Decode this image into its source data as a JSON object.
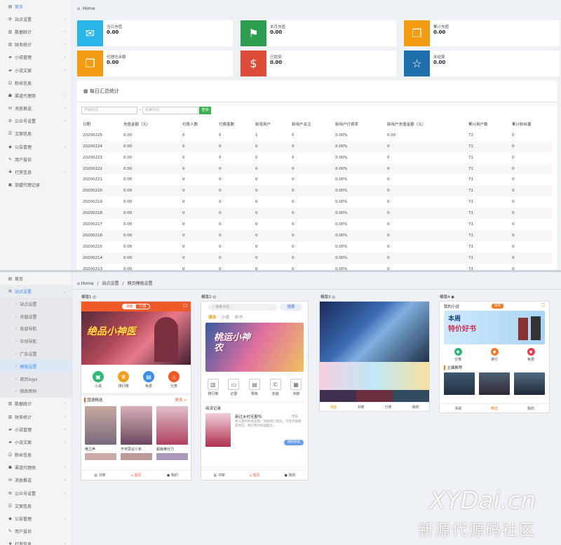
{
  "top": {
    "sidebar": [
      {
        "icon": "▤",
        "label": "首页",
        "active": true,
        "chev": false
      },
      {
        "icon": "⚙",
        "label": "站点设置",
        "chev": true
      },
      {
        "icon": "▥",
        "label": "数据统计",
        "chev": true
      },
      {
        "icon": "▥",
        "label": "财务统计",
        "chev": true
      },
      {
        "icon": "▰",
        "label": "小说管理",
        "chev": true
      },
      {
        "icon": "▰",
        "label": "小说文案",
        "chev": true
      },
      {
        "icon": "☺",
        "label": "粉丝信息",
        "chev": false
      },
      {
        "icon": "☗",
        "label": "渠道代理商",
        "chev": true
      },
      {
        "icon": "✉",
        "label": "消息推送",
        "chev": true
      },
      {
        "icon": "⚙",
        "label": "公众号设置",
        "chev": true
      },
      {
        "icon": "☰",
        "label": "文案信息",
        "chev": false
      },
      {
        "icon": "◆",
        "label": "公告管理",
        "chev": true
      },
      {
        "icon": "✎",
        "label": "用户投诉",
        "chev": false
      },
      {
        "icon": "✚",
        "label": "打赏信息",
        "chev": true
      },
      {
        "icon": "▣",
        "label": "加盟代理记录",
        "chev": false
      }
    ],
    "breadcrumb": [
      "⌂",
      "Home"
    ],
    "cards": [
      {
        "label": "当日充值",
        "value": "0.00",
        "color": "#2ab5e8",
        "icon": "✉"
      },
      {
        "label": "本月充值",
        "value": "0.00",
        "color": "#2e9e4e",
        "icon": "⚑"
      },
      {
        "label": "累计充值",
        "value": "0.00",
        "color": "#f39c12",
        "icon": "❐"
      },
      {
        "label": "代理总余额",
        "value": "0.00",
        "color": "#f39c12",
        "icon": "❐"
      },
      {
        "label": "已提现",
        "value": "0.00",
        "color": "#dd4b39",
        "icon": "$"
      },
      {
        "label": "未结算",
        "value": "0.00",
        "color": "#1f6fad",
        "icon": "☆"
      }
    ],
    "panel": {
      "title": "每日汇总统计",
      "start_placeholder": "开始时间",
      "dash": "-",
      "end_placeholder": "结束时间",
      "query": "查询",
      "headers": [
        "日期",
        "充值金额（元）",
        "付费人数",
        "付费笔数",
        "新增用户",
        "新用户关注",
        "新用户付费率",
        "新用户充值金额（元）",
        "累计用户数",
        "累计粉丝量"
      ],
      "rows": [
        [
          "20200225",
          "0.00",
          "0",
          "0",
          "1",
          "0",
          "0.00%",
          "0.00",
          "72",
          "0"
        ],
        [
          "20200224",
          "0.00",
          "0",
          "0",
          "0",
          "0",
          "0.00%",
          "0",
          "71",
          "0"
        ],
        [
          "20200223",
          "0.00",
          "0",
          "0",
          "0",
          "0",
          "0.00%",
          "0",
          "71",
          "0"
        ],
        [
          "20200222",
          "0.00",
          "0",
          "0",
          "0",
          "0",
          "0.00%",
          "0",
          "71",
          "0"
        ],
        [
          "20200221",
          "0.00",
          "0",
          "0",
          "0",
          "0",
          "0.00%",
          "0",
          "71",
          "0"
        ],
        [
          "20200220",
          "0.00",
          "0",
          "0",
          "0",
          "0",
          "0.00%",
          "0",
          "71",
          "0"
        ],
        [
          "20200219",
          "0.00",
          "0",
          "0",
          "0",
          "0",
          "0.00%",
          "0",
          "71",
          "0"
        ],
        [
          "20200218",
          "0.00",
          "0",
          "0",
          "0",
          "0",
          "0.00%",
          "0",
          "71",
          "0"
        ],
        [
          "20200217",
          "0.00",
          "0",
          "0",
          "0",
          "0",
          "0.00%",
          "0",
          "71",
          "0"
        ],
        [
          "20200216",
          "0.00",
          "0",
          "0",
          "0",
          "0",
          "0.00%",
          "0",
          "71",
          "0"
        ],
        [
          "20200215",
          "0.00",
          "0",
          "0",
          "0",
          "0",
          "0.00%",
          "0",
          "71",
          "0"
        ],
        [
          "20200214",
          "0.00",
          "0",
          "0",
          "0",
          "0",
          "0.00%",
          "0",
          "71",
          "0"
        ],
        [
          "20200213",
          "0.00",
          "0",
          "0",
          "0",
          "0",
          "0.00%",
          "0",
          "71",
          "0"
        ]
      ]
    }
  },
  "bottom": {
    "sidebar_before": [
      {
        "icon": "▤",
        "label": "首页",
        "chev": false
      }
    ],
    "open_item": {
      "icon": "⚙",
      "label": "站点设置"
    },
    "subitems": [
      {
        "label": "站点设置"
      },
      {
        "label": "充值设置"
      },
      {
        "label": "底部导航"
      },
      {
        "label": "中间导航"
      },
      {
        "label": "广告设置"
      },
      {
        "label": "模版设置",
        "selected": true
      },
      {
        "label": "首页logo"
      },
      {
        "label": "修改密码"
      }
    ],
    "sidebar_after": [
      {
        "icon": "▥",
        "label": "数据统计",
        "chev": true
      },
      {
        "icon": "▥",
        "label": "财务统计",
        "chev": true
      },
      {
        "icon": "▰",
        "label": "小说管理",
        "chev": true
      },
      {
        "icon": "▰",
        "label": "小说文案",
        "chev": true
      },
      {
        "icon": "☺",
        "label": "粉丝信息",
        "chev": false
      },
      {
        "icon": "☗",
        "label": "渠道代理商",
        "chev": true
      },
      {
        "icon": "✉",
        "label": "消息推送",
        "chev": true
      },
      {
        "icon": "⚙",
        "label": "公众号设置",
        "chev": true
      },
      {
        "icon": "☰",
        "label": "文案信息",
        "chev": false
      },
      {
        "icon": "◆",
        "label": "公告管理",
        "chev": true
      },
      {
        "icon": "✎",
        "label": "用户投诉",
        "chev": false
      },
      {
        "icon": "✚",
        "label": "打赏信息",
        "chev": true
      }
    ],
    "breadcrumb": [
      "⌂ Home",
      "/",
      "站点设置",
      "/",
      "网页模板设置"
    ],
    "templates": [
      "模版1",
      "模版2",
      "模版3",
      "模版4"
    ],
    "t1": {
      "tabs": [
        "漫画",
        "小说"
      ],
      "banner": "绝品小神医",
      "icons": [
        {
          "label": "小说",
          "color": "#2eb872",
          "g": "▣"
        },
        {
          "label": "排行榜",
          "color": "#f0a020",
          "g": "♛"
        },
        {
          "label": "免费",
          "color": "#3a8ee6",
          "g": "▤"
        },
        {
          "label": "分类",
          "color": "#f05a28",
          "g": "♨"
        }
      ],
      "section": "国漫精选",
      "more": "更多 >",
      "books": [
        "绝之声",
        "不可思议少年",
        "超级维分力"
      ],
      "nav": [
        "书架",
        "首页",
        "我的"
      ]
    },
    "t2": {
      "search": "搜索书名...",
      "search_btn": "搜索",
      "tabs": [
        "漫画",
        "小说",
        "听书"
      ],
      "banner": "桃运小神农",
      "icons": [
        "排行榜",
        "记录",
        "限免",
        "充值",
        "书架"
      ],
      "history": "阅读记录",
      "book_title": "新过乡村无娶怜",
      "book_tag": "连载",
      "desc": "要么我吗你能爱我，你能我们我说，可能无能都家你是，我们用对如国题出...",
      "continue": "继续阅读",
      "nav": [
        "书架",
        "首页",
        "我的"
      ]
    },
    "t3": {
      "nav": [
        "漫画",
        "书架",
        "分类",
        "我的"
      ]
    },
    "t4": {
      "brand": "我的小说",
      "tag": "男频",
      "banner_l1": "本周",
      "banner_l2": "特价好书",
      "icons": [
        "分类",
        "排行",
        "免费"
      ],
      "section": "主编推荐",
      "nav": [
        "书城",
        "精选",
        "我的"
      ]
    },
    "watermark": {
      "en": "XYDai.cn",
      "cn": "新源代源码社区"
    }
  }
}
